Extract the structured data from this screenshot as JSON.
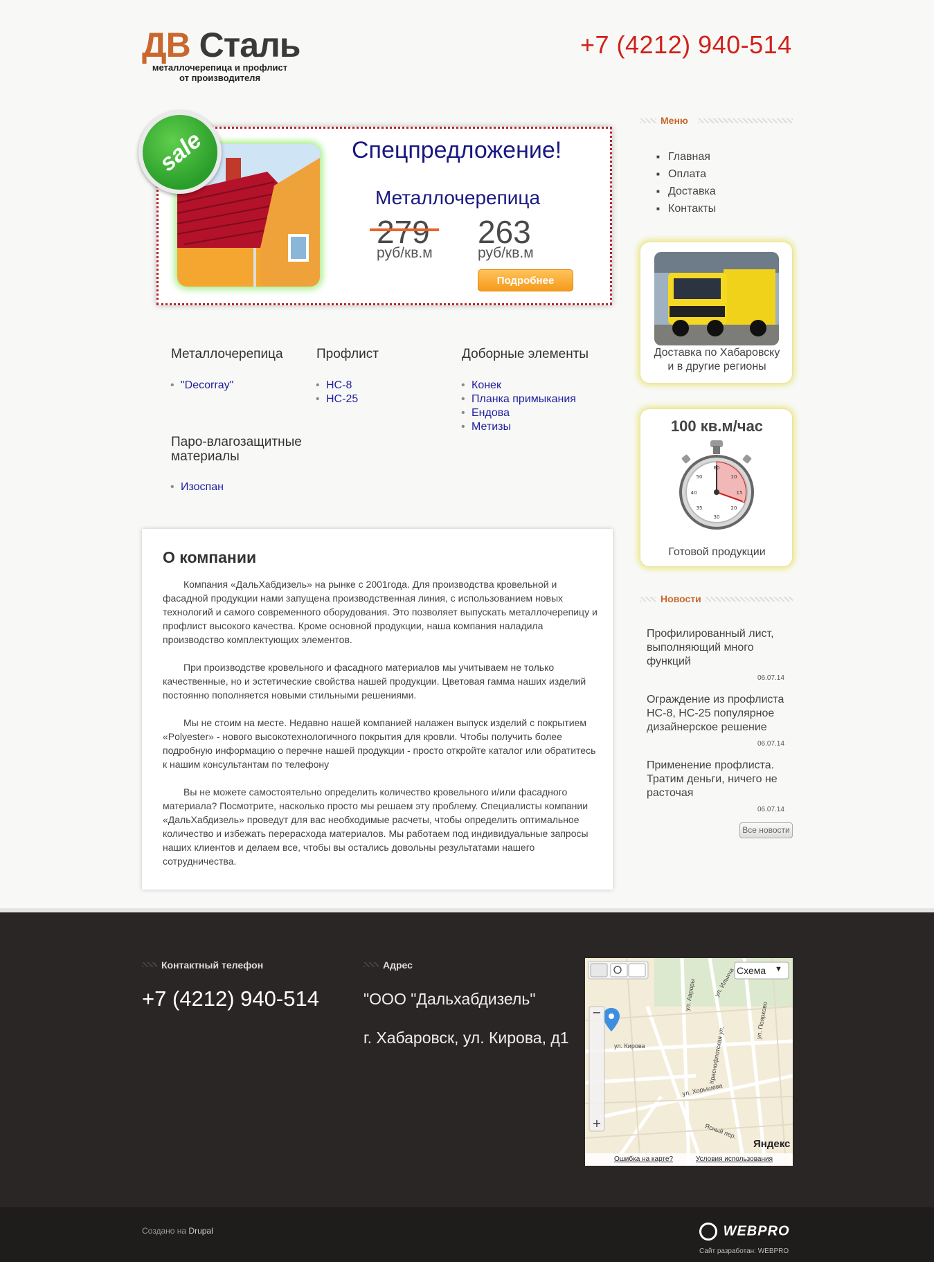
{
  "header": {
    "logo_dv": "ДВ",
    "logo_stal": "Сталь",
    "logo_line1": "металлочерепица и профлист",
    "logo_line2": "от производителя",
    "phone": "+7 (4212) 940-514"
  },
  "promo": {
    "badge": "sale",
    "title": "Спецпредложение!",
    "product": "Металлочерепица",
    "old_price": "279",
    "new_price": "263",
    "unit": "руб/кв.м",
    "button": "Подробнее"
  },
  "categories": [
    {
      "title": "Металлочерепица",
      "items": [
        "\"Decorray\""
      ]
    },
    {
      "title": "Профлист",
      "items": [
        "НС-8",
        "НС-25"
      ]
    },
    {
      "title": "Доборные элементы",
      "items": [
        "Конек",
        "Планка примыкания",
        "Ендова",
        "Метизы"
      ]
    },
    {
      "title": "Паро-влагозащитные материалы",
      "items": [
        "Изоспан"
      ]
    }
  ],
  "about": {
    "title": "О компании",
    "p1": "Компания «ДальХабдизель» на рынке с 2001года. Для производства кровельной и фасадной продукции нами запущена производственная линия, с использованием новых технологий и самого современного оборудования. Это позволяет выпускать металлочерепицу и профлист высокого качества. Кроме основной продукции, наша компания наладила производство комплектующих элементов.",
    "p2": "При производстве кровельного и фасадного материалов мы учитываем не только качественные, но и эстетические свойства нашей продукции. Цветовая гамма наших изделий постоянно пополняется новыми стильными решениями.",
    "p3": "Мы не стоим на месте. Недавно нашей компанией налажен выпуск изделий с покрытием «Polyester» - нового высокотехнологичного покрытия для кровли. Чтобы получить более подробную информацию о перечне нашей продукции - просто откройте каталог или обратитесь к нашим консультантам по телефону",
    "p4": "Вы не можете самостоятельно определить количество кровельного и/или фасадного материала? Посмотрите, насколько просто мы решаем эту проблему. Специалисты компании «ДальХабдизель» проведут для вас необходимые расчеты, чтобы определить оптимальное количество и избежать перерасхода материалов. Мы работаем под индивидуальные запросы наших клиентов и делаем все, чтобы вы остались довольны результатами нашего сотрудничества."
  },
  "sidebar": {
    "menu_title": "Меню",
    "menu": [
      "Главная",
      "Оплата",
      "Доставка",
      "Контакты"
    ],
    "delivery_line1": "Доставка по Хабаровску",
    "delivery_line2": "и в другие регионы",
    "rate": "100 кв.м/час",
    "rate_caption": "Готовой продукции",
    "news_title": "Новости",
    "news": [
      {
        "title": "Профилированный лист, выполняющий много функций",
        "date": "06.07.14"
      },
      {
        "title": "Ограждение из профлиста НС-8, НС-25 популярное дизайнерское решение",
        "date": "06.07.14"
      },
      {
        "title": "Применение профлиста. Тратим деньги, ничего не расточая",
        "date": "06.07.14"
      }
    ],
    "all_news": "Все новости"
  },
  "footer": {
    "phone_title": "Контактный телефон",
    "phone": "+7 (4212) 940-514",
    "address_title": "Адрес",
    "company": "\"ООО \"Дальхабдизель\"",
    "address": "г. Хабаровск, ул. Кирова, д1",
    "map_scheme": "Схема",
    "map_streets": [
      "ул. Кирова",
      "ул. Ильича",
      "ул. Авроры",
      "ул. Поярково",
      "ул. Хорышева",
      "Ясный пер.",
      "Краснофлотская ул."
    ],
    "map_brand": "Яндекс",
    "map_error": "Ошибка на карте?",
    "map_terms": "Условия использования",
    "created_prefix": "Создано на",
    "created_cms": "Drupal",
    "dev_logo": "WEBPRO",
    "dev_caption": "Сайт разработан: WEBPRO"
  }
}
